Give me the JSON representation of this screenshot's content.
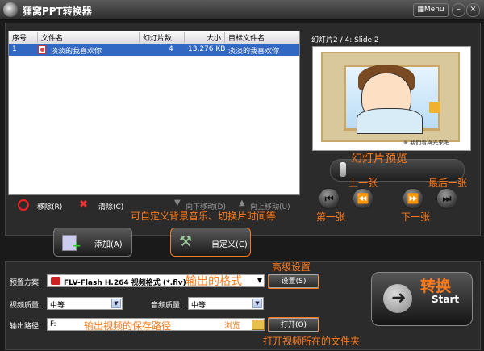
{
  "window": {
    "title": "狸窝PPT转换器",
    "menu_label": "Menu",
    "min_glyph": "–",
    "close_glyph": "×"
  },
  "file_list": {
    "columns": [
      "序号",
      "文件名",
      "幻灯片数",
      "大小",
      "目标文件名"
    ],
    "rows": [
      {
        "index": "1",
        "name": "淡淡的我喜欢你",
        "slides": "4",
        "size": "13,276 KB",
        "target": "淡淡的我喜欢你"
      }
    ]
  },
  "list_toolbar": {
    "remove": "移除(R)",
    "clear": "清除(C)",
    "move_down": "向下移动(D)",
    "move_up": "向上移动(U)"
  },
  "preview": {
    "label": "幻灯片2 / 4: Slide 2",
    "caption": "※ 我們看與光來吧",
    "progress": 0.02
  },
  "buttons": {
    "add": "添加(A)",
    "customize": "自定义(C)",
    "settings": "设置(S)",
    "open": "打开(O)",
    "browse": "浏览",
    "start": "Start"
  },
  "form": {
    "preset_label": "预置方案:",
    "preset_value": "FLV-Flash H.264 视频格式 (*.flv)",
    "video_quality_label": "视频质量:",
    "video_quality_value": "中等",
    "audio_quality_label": "音频质量:",
    "audio_quality_value": "中等",
    "output_label": "输出路径:",
    "output_value": "F:"
  },
  "annotations": {
    "custom": "可自定义背景音乐、切换片时间等",
    "preview": "幻灯片预览",
    "prev": "上一张",
    "last": "最后一张",
    "first": "第一张",
    "next": "下一张",
    "advanced": "高级设置",
    "format": "输出的格式",
    "save_path": "输出视频的保存路径",
    "convert": "转换",
    "open_folder": "打开视频所在的文件夹"
  },
  "colors": {
    "annotation": "#ff7a1a",
    "selection": "#3168c4",
    "background": "#1a1a1a"
  }
}
